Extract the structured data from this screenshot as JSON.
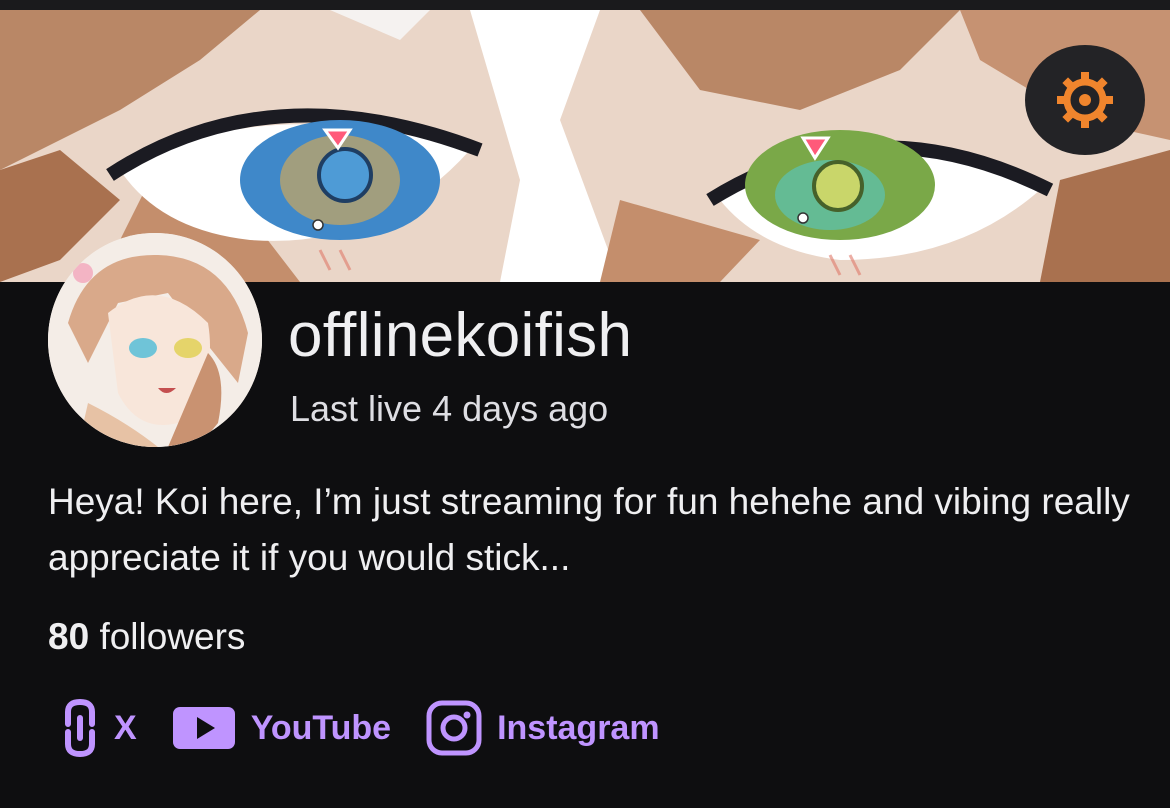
{
  "channel": {
    "username": "offlinekoifish",
    "last_live": "Last live 4 days ago",
    "bio": "Heya! Koi here, I’m just streaming for fun hehehe and vibing really appreciate it if you would stick...",
    "followers_count": "80",
    "followers_label": "followers"
  },
  "socials": [
    {
      "label": "X",
      "icon": "link-icon"
    },
    {
      "label": "YouTube",
      "icon": "youtube-icon"
    },
    {
      "label": "Instagram",
      "icon": "instagram-icon"
    }
  ],
  "colors": {
    "background": "#0e0e10",
    "accent": "#bf94ff",
    "settings_icon": "#f0852d"
  }
}
